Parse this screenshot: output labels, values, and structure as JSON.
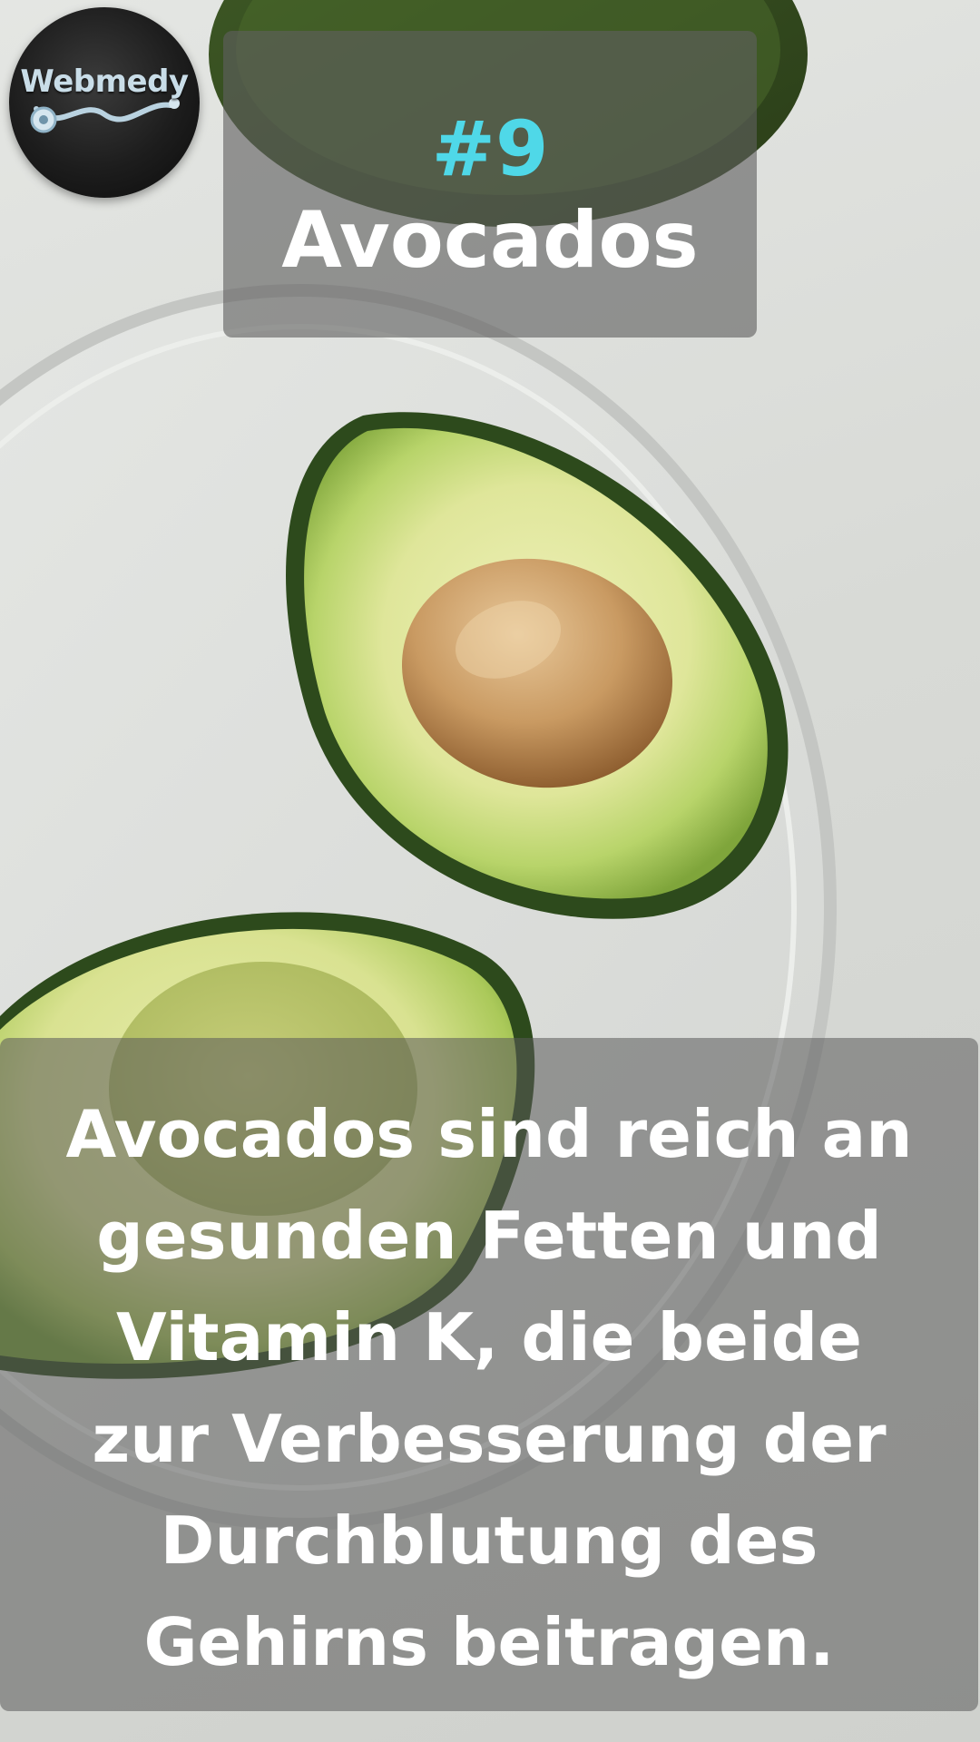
{
  "logo": {
    "text": "Webmedy"
  },
  "title": {
    "number": "#9",
    "name": "Avocados"
  },
  "description": {
    "lines": [
      "Avocados sind reich an",
      "gesunden Fetten und",
      "Vitamin K, die beide",
      "zur Verbesserung der",
      "Durchblutung des",
      "Gehirns beitragen."
    ]
  },
  "colors": {
    "accent_number": "#4fd8e8",
    "text": "#ffffff",
    "panel": "#5f5f5f"
  }
}
